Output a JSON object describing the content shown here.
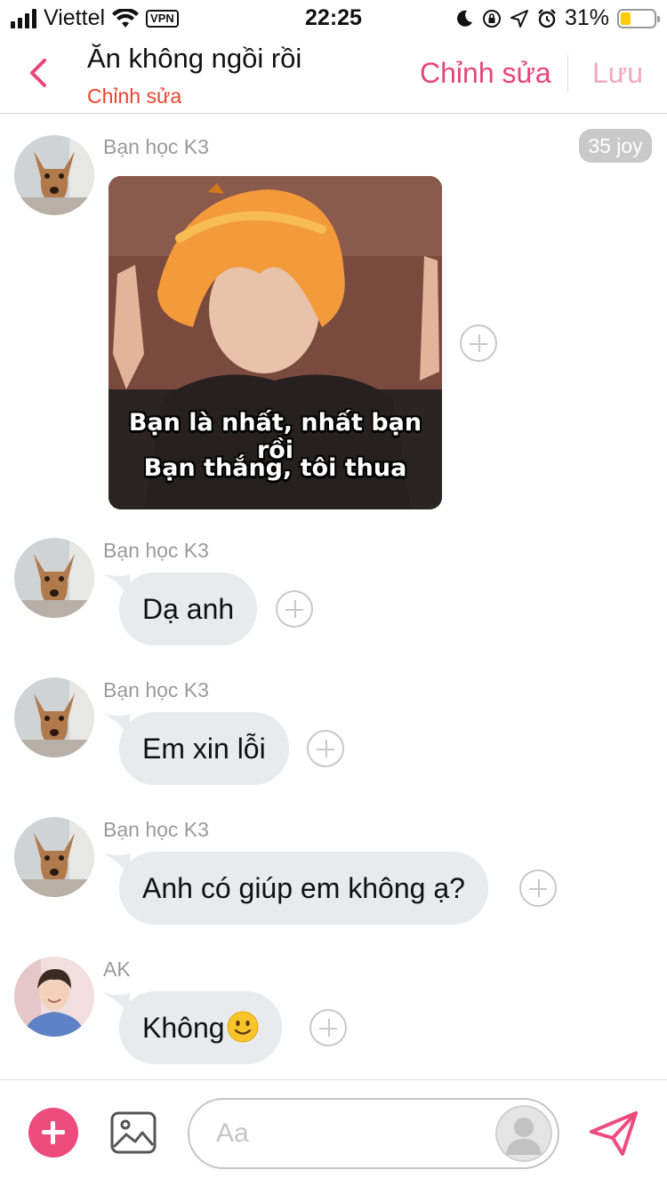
{
  "status_bar": {
    "carrier": "Viettel",
    "vpn": "VPN",
    "time": "22:25",
    "battery_percent": "31%",
    "battery_level": 0.31
  },
  "header": {
    "title": "Ăn không ngồi rồi",
    "subtitle": "Chỉnh sửa",
    "edit_label": "Chỉnh sửa",
    "save_label": "Lưu"
  },
  "messages": [
    {
      "sender": "Bạn học K3",
      "badge": "35 joy",
      "type": "sticker",
      "caption_line1": "Bạn là nhất, nhất bạn rồi",
      "caption_line2": "Bạn thắng, tôi thua"
    },
    {
      "sender": "Bạn học K3",
      "type": "text",
      "text": "Dạ anh"
    },
    {
      "sender": "Bạn học K3",
      "type": "text",
      "text": "Em xin lỗi"
    },
    {
      "sender": "Bạn học K3",
      "type": "text",
      "text": "Anh có giúp em không ạ?"
    },
    {
      "sender": "AK",
      "type": "text",
      "text": "Không",
      "emoji": "smiley-icon"
    }
  ],
  "composer": {
    "placeholder": "Aa"
  },
  "colors": {
    "accent": "#ee4b7d",
    "subtitle": "#e8442c",
    "save_disabled": "#f4a7c1",
    "bubble": "#e9eaec"
  }
}
